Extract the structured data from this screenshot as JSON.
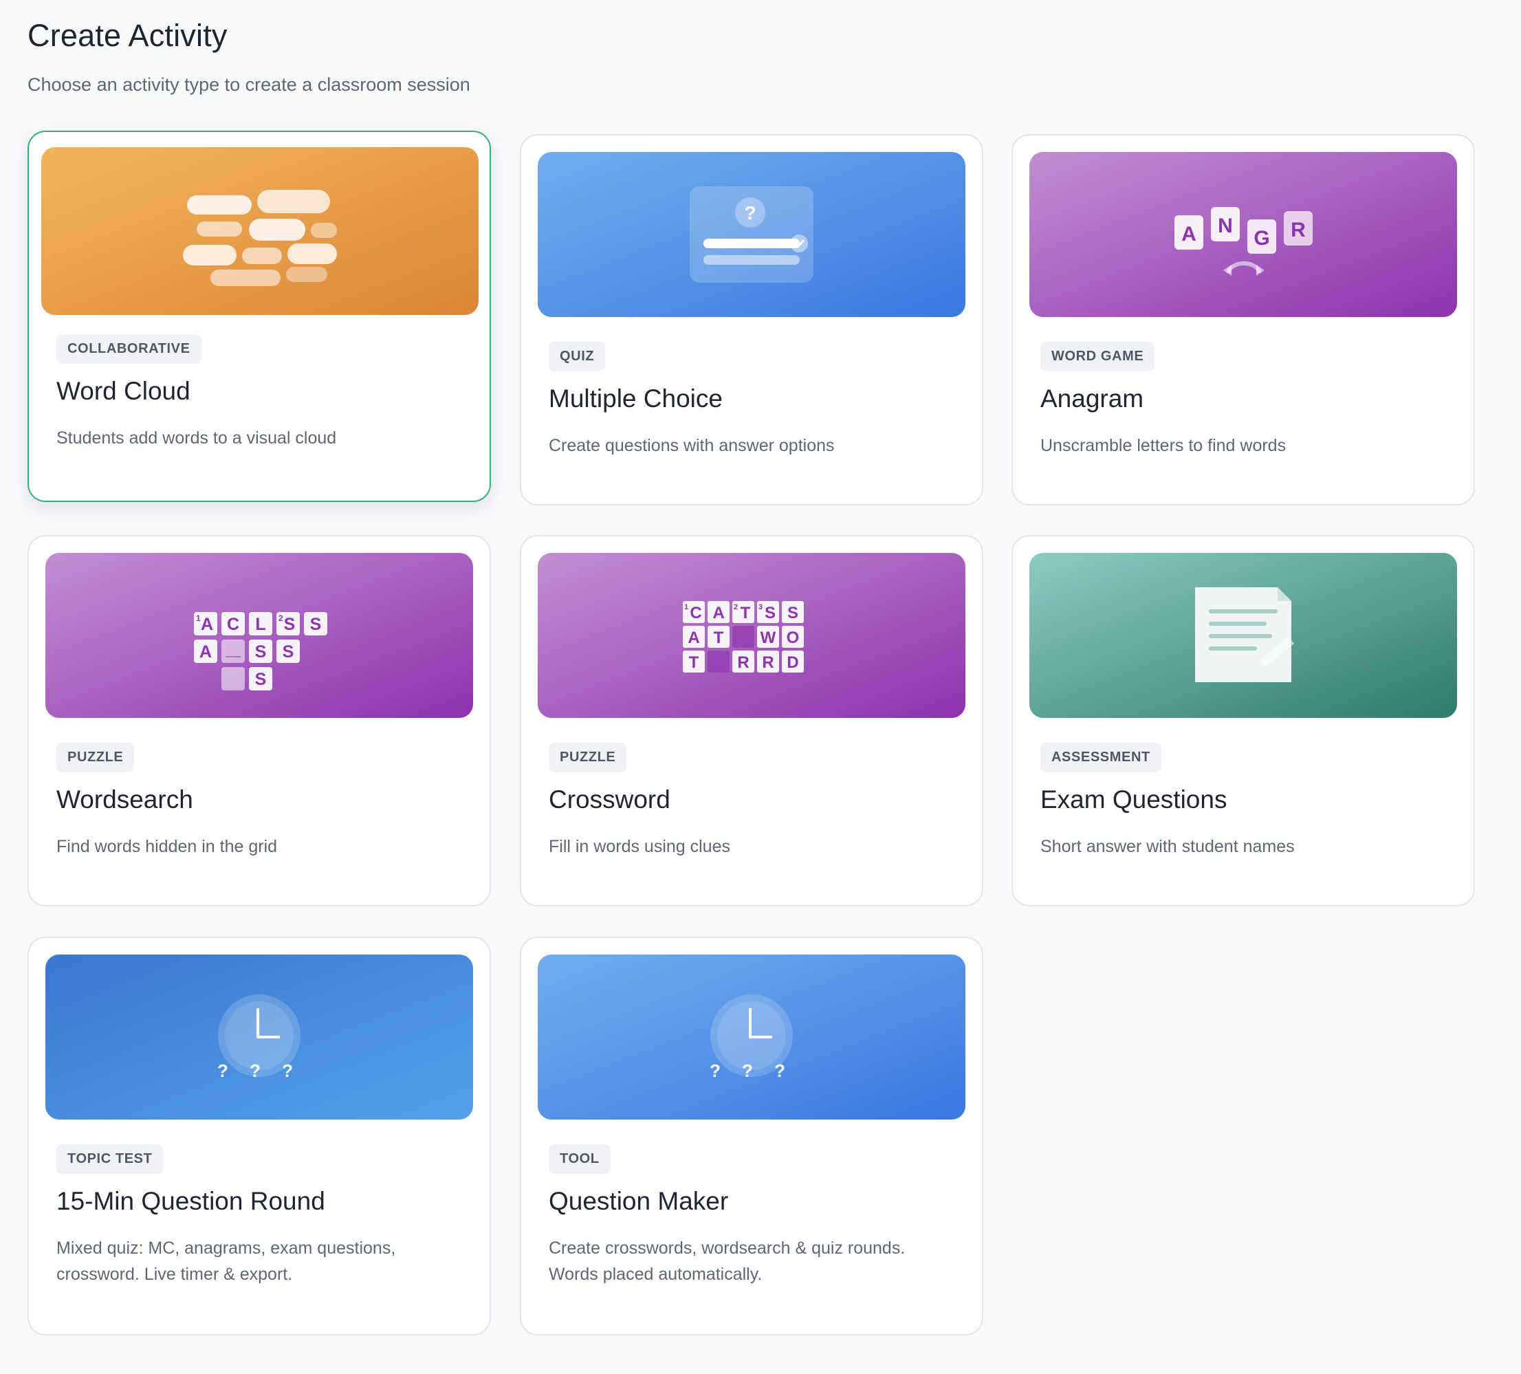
{
  "header": {
    "title": "Create Activity",
    "subtitle": "Choose an activity type to create a classroom session"
  },
  "cards": [
    {
      "category": "COLLABORATIVE",
      "title": "Word Cloud",
      "description": "Students add words to a visual cloud",
      "selected": true,
      "colors": {
        "from": "#f3b45c",
        "to": "#dc8638"
      }
    },
    {
      "category": "QUIZ",
      "title": "Multiple Choice",
      "description": "Create questions with answer options",
      "icon_glyph": "?",
      "colors": {
        "from": "#73aeee",
        "to": "#3878e0"
      }
    },
    {
      "category": "WORD GAME",
      "title": "Anagram",
      "description": "Unscramble letters to find words",
      "tiles": [
        "A",
        "N",
        "G",
        "R"
      ],
      "colors": {
        "from": "#c38ed3",
        "to": "#8d33ad"
      }
    },
    {
      "category": "PUZZLE",
      "title": "Wordsearch",
      "description": "Find words hidden in the grid",
      "grid": {
        "row1": [
          "A",
          "C",
          "L",
          "S",
          "S"
        ],
        "row2": [
          "A",
          "S",
          "S"
        ],
        "row3": [
          "S"
        ],
        "numbers": [
          "1",
          "2"
        ]
      },
      "colors": {
        "from": "#c38ed3",
        "to": "#8d33ad"
      }
    },
    {
      "category": "PUZZLE",
      "title": "Crossword",
      "description": "Fill in words using clues",
      "grid": {
        "row1": [
          "C",
          "A",
          "T",
          "S",
          "S"
        ],
        "row2": [
          "A",
          "T",
          "W",
          "O"
        ],
        "row3": [
          "T",
          "R",
          "R",
          "D"
        ],
        "numbers": [
          "1",
          "2",
          "3"
        ]
      },
      "colors": {
        "from": "#c38ed3",
        "to": "#8d33ad"
      }
    },
    {
      "category": "ASSESSMENT",
      "title": "Exam Questions",
      "description": "Short answer with student names",
      "colors": {
        "from": "#8ecbc2",
        "to": "#2f7a6b"
      }
    },
    {
      "category": "TOPIC TEST",
      "title": "15-Min Question Round",
      "description": "Mixed quiz: MC, anagrams, exam questions, crossword. Live timer & export.",
      "icon_glyph": "? ? ?",
      "colors": {
        "from": "#3a78d0",
        "to": "#55a0ea"
      }
    },
    {
      "category": "TOOL",
      "title": "Question Maker",
      "description": "Create crosswords, wordsearch & quiz rounds. Words placed automatically.",
      "icon_glyph": "? ? ?",
      "colors": {
        "from": "#73aeee",
        "to": "#3878e0"
      }
    }
  ]
}
